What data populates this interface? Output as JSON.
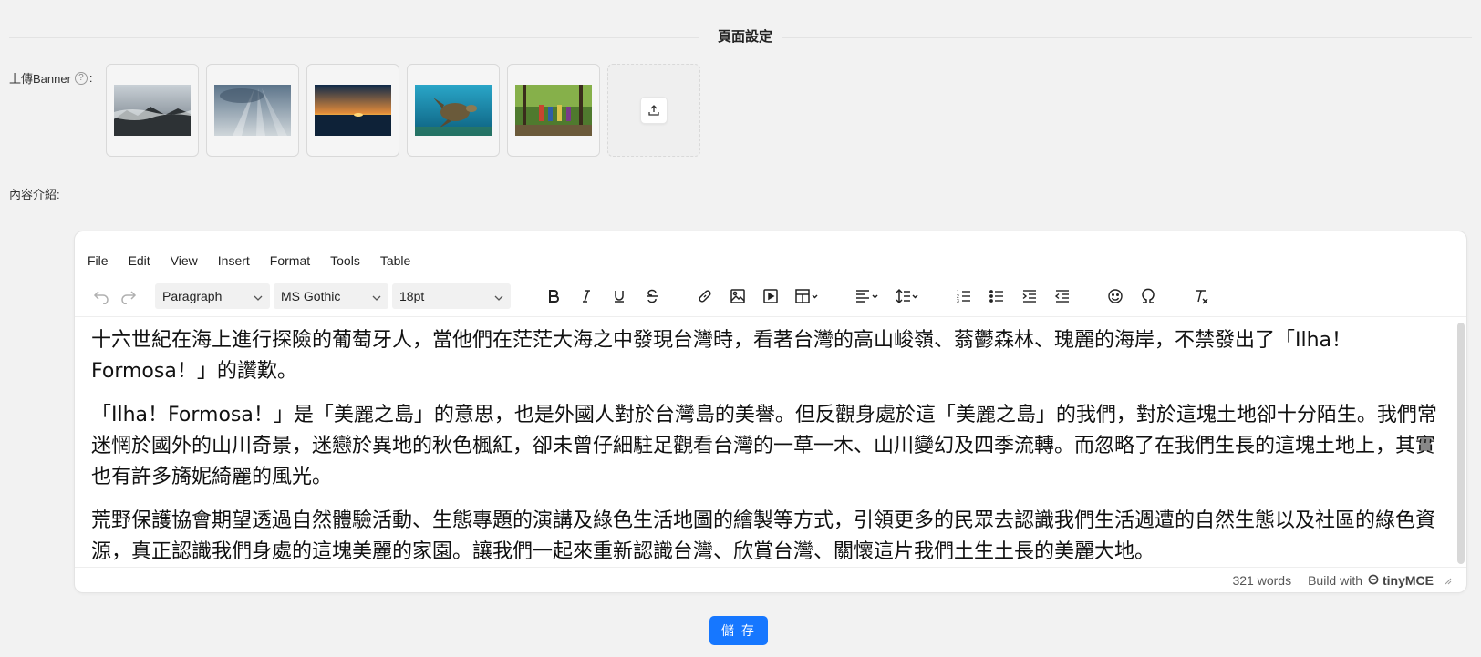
{
  "section": {
    "title": "頁面設定"
  },
  "banner": {
    "label": "上傳Banner",
    "help_glyph": "?",
    "colon": ":"
  },
  "thumbnails": [
    {
      "name": "mountain-mist"
    },
    {
      "name": "sun-rays"
    },
    {
      "name": "sunset-sea"
    },
    {
      "name": "sea-turtle"
    },
    {
      "name": "forest-hikers"
    }
  ],
  "content": {
    "label": "內容介紹:"
  },
  "editor": {
    "menu": [
      "File",
      "Edit",
      "View",
      "Insert",
      "Format",
      "Tools",
      "Table"
    ],
    "block_format": "Paragraph",
    "font_family": "MS Gothic",
    "font_size": "18pt",
    "paragraphs": [
      "十六世紀在海上進行探險的葡萄牙人，當他們在茫茫大海之中發現台灣時，看著台灣的高山峻嶺、蓊鬱森林、瑰麗的海岸，不禁發出了「Ilha！Formosa！」的讚歎。",
      "「Ilha！Formosa！」是「美麗之島」的意思，也是外國人對於台灣島的美譽。但反觀身處於這「美麗之島」的我們，對於這塊土地卻十分陌生。我們常迷惘於國外的山川奇景，迷戀於異地的秋色楓紅，卻未曾仔細駐足觀看台灣的一草一木、山川變幻及四季流轉。而忽略了在我們生長的這塊土地上，其實也有許多旖妮綺麗的風光。",
      "荒野保護協會期望透過自然體驗活動、生態專題的演講及綠色生活地圖的繪製等方式，引領更多的民眾去認識我們生活週遭的自然生態以及社區的綠色資源，真正認識我們身處的這塊美麗的家園。讓我們一起來重新認識台灣、欣賞台灣、關懷這片我們土生土長的美麗大地。"
    ],
    "word_count": "321 words",
    "build_with": "Build with",
    "brand": "tinyMCE"
  },
  "save_button": {
    "label": "儲 存"
  },
  "colors": {
    "primary": "#1677ff",
    "background": "#f2f2f2"
  }
}
